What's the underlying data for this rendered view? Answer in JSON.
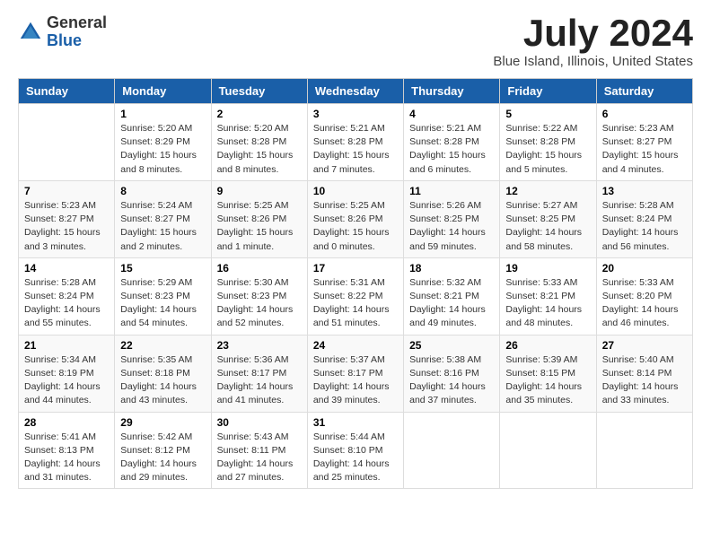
{
  "logo": {
    "text_general": "General",
    "text_blue": "Blue"
  },
  "title": {
    "month": "July 2024",
    "location": "Blue Island, Illinois, United States"
  },
  "weekdays": [
    "Sunday",
    "Monday",
    "Tuesday",
    "Wednesday",
    "Thursday",
    "Friday",
    "Saturday"
  ],
  "weeks": [
    [
      {
        "day": "",
        "info": ""
      },
      {
        "day": "1",
        "info": "Sunrise: 5:20 AM\nSunset: 8:29 PM\nDaylight: 15 hours\nand 8 minutes."
      },
      {
        "day": "2",
        "info": "Sunrise: 5:20 AM\nSunset: 8:28 PM\nDaylight: 15 hours\nand 8 minutes."
      },
      {
        "day": "3",
        "info": "Sunrise: 5:21 AM\nSunset: 8:28 PM\nDaylight: 15 hours\nand 7 minutes."
      },
      {
        "day": "4",
        "info": "Sunrise: 5:21 AM\nSunset: 8:28 PM\nDaylight: 15 hours\nand 6 minutes."
      },
      {
        "day": "5",
        "info": "Sunrise: 5:22 AM\nSunset: 8:28 PM\nDaylight: 15 hours\nand 5 minutes."
      },
      {
        "day": "6",
        "info": "Sunrise: 5:23 AM\nSunset: 8:27 PM\nDaylight: 15 hours\nand 4 minutes."
      }
    ],
    [
      {
        "day": "7",
        "info": "Sunrise: 5:23 AM\nSunset: 8:27 PM\nDaylight: 15 hours\nand 3 minutes."
      },
      {
        "day": "8",
        "info": "Sunrise: 5:24 AM\nSunset: 8:27 PM\nDaylight: 15 hours\nand 2 minutes."
      },
      {
        "day": "9",
        "info": "Sunrise: 5:25 AM\nSunset: 8:26 PM\nDaylight: 15 hours\nand 1 minute."
      },
      {
        "day": "10",
        "info": "Sunrise: 5:25 AM\nSunset: 8:26 PM\nDaylight: 15 hours\nand 0 minutes."
      },
      {
        "day": "11",
        "info": "Sunrise: 5:26 AM\nSunset: 8:25 PM\nDaylight: 14 hours\nand 59 minutes."
      },
      {
        "day": "12",
        "info": "Sunrise: 5:27 AM\nSunset: 8:25 PM\nDaylight: 14 hours\nand 58 minutes."
      },
      {
        "day": "13",
        "info": "Sunrise: 5:28 AM\nSunset: 8:24 PM\nDaylight: 14 hours\nand 56 minutes."
      }
    ],
    [
      {
        "day": "14",
        "info": "Sunrise: 5:28 AM\nSunset: 8:24 PM\nDaylight: 14 hours\nand 55 minutes."
      },
      {
        "day": "15",
        "info": "Sunrise: 5:29 AM\nSunset: 8:23 PM\nDaylight: 14 hours\nand 54 minutes."
      },
      {
        "day": "16",
        "info": "Sunrise: 5:30 AM\nSunset: 8:23 PM\nDaylight: 14 hours\nand 52 minutes."
      },
      {
        "day": "17",
        "info": "Sunrise: 5:31 AM\nSunset: 8:22 PM\nDaylight: 14 hours\nand 51 minutes."
      },
      {
        "day": "18",
        "info": "Sunrise: 5:32 AM\nSunset: 8:21 PM\nDaylight: 14 hours\nand 49 minutes."
      },
      {
        "day": "19",
        "info": "Sunrise: 5:33 AM\nSunset: 8:21 PM\nDaylight: 14 hours\nand 48 minutes."
      },
      {
        "day": "20",
        "info": "Sunrise: 5:33 AM\nSunset: 8:20 PM\nDaylight: 14 hours\nand 46 minutes."
      }
    ],
    [
      {
        "day": "21",
        "info": "Sunrise: 5:34 AM\nSunset: 8:19 PM\nDaylight: 14 hours\nand 44 minutes."
      },
      {
        "day": "22",
        "info": "Sunrise: 5:35 AM\nSunset: 8:18 PM\nDaylight: 14 hours\nand 43 minutes."
      },
      {
        "day": "23",
        "info": "Sunrise: 5:36 AM\nSunset: 8:17 PM\nDaylight: 14 hours\nand 41 minutes."
      },
      {
        "day": "24",
        "info": "Sunrise: 5:37 AM\nSunset: 8:17 PM\nDaylight: 14 hours\nand 39 minutes."
      },
      {
        "day": "25",
        "info": "Sunrise: 5:38 AM\nSunset: 8:16 PM\nDaylight: 14 hours\nand 37 minutes."
      },
      {
        "day": "26",
        "info": "Sunrise: 5:39 AM\nSunset: 8:15 PM\nDaylight: 14 hours\nand 35 minutes."
      },
      {
        "day": "27",
        "info": "Sunrise: 5:40 AM\nSunset: 8:14 PM\nDaylight: 14 hours\nand 33 minutes."
      }
    ],
    [
      {
        "day": "28",
        "info": "Sunrise: 5:41 AM\nSunset: 8:13 PM\nDaylight: 14 hours\nand 31 minutes."
      },
      {
        "day": "29",
        "info": "Sunrise: 5:42 AM\nSunset: 8:12 PM\nDaylight: 14 hours\nand 29 minutes."
      },
      {
        "day": "30",
        "info": "Sunrise: 5:43 AM\nSunset: 8:11 PM\nDaylight: 14 hours\nand 27 minutes."
      },
      {
        "day": "31",
        "info": "Sunrise: 5:44 AM\nSunset: 8:10 PM\nDaylight: 14 hours\nand 25 minutes."
      },
      {
        "day": "",
        "info": ""
      },
      {
        "day": "",
        "info": ""
      },
      {
        "day": "",
        "info": ""
      }
    ]
  ]
}
